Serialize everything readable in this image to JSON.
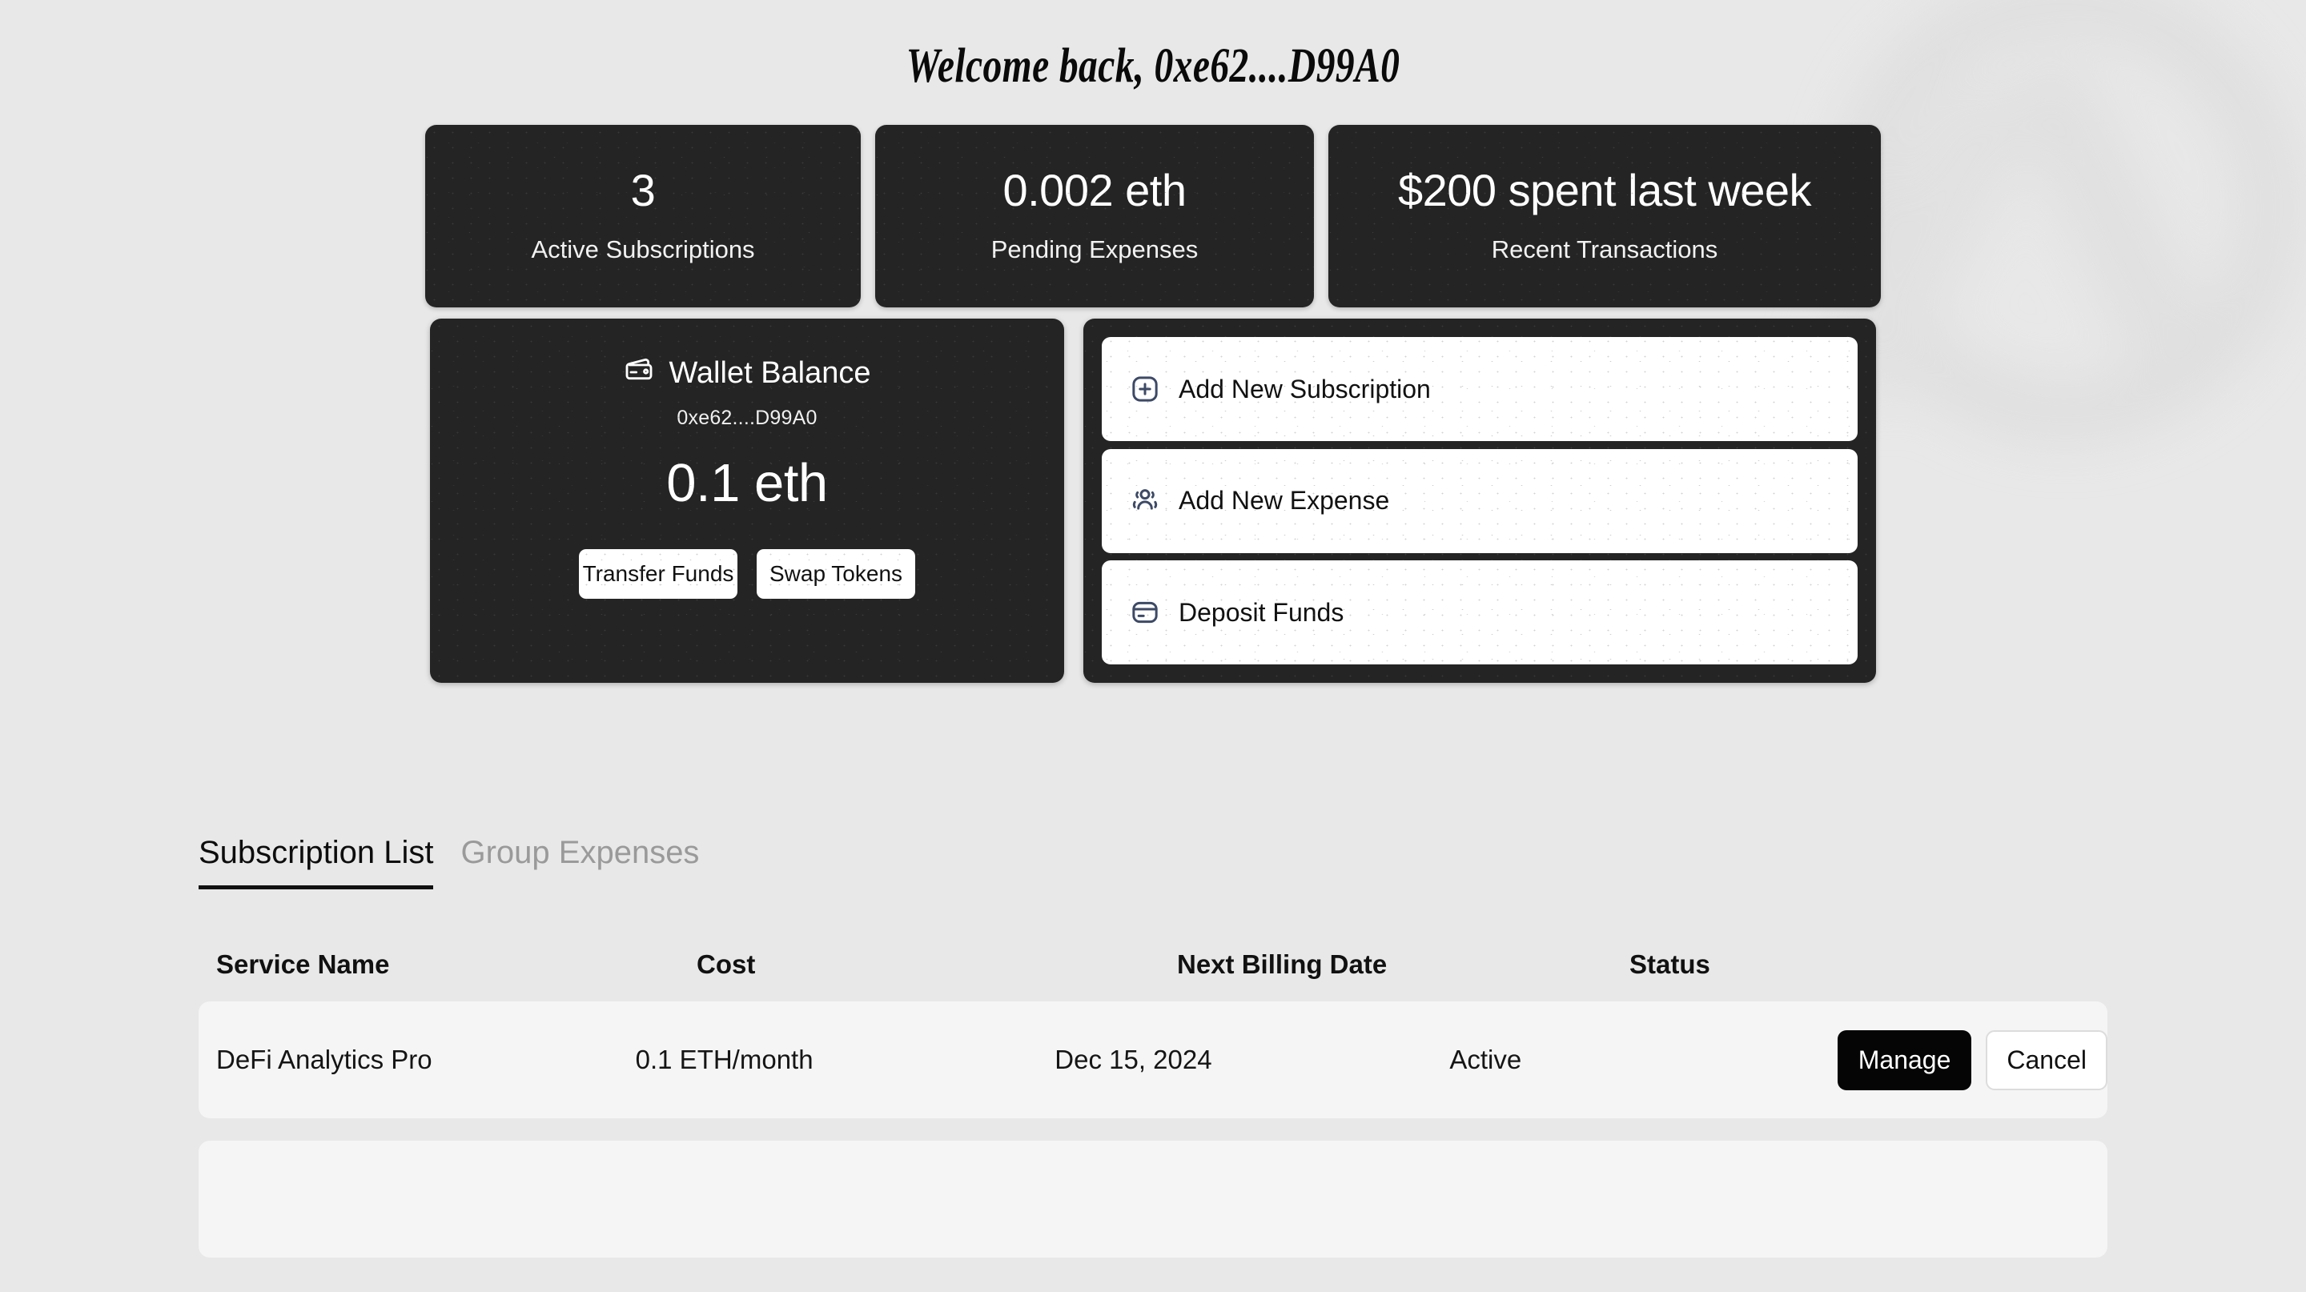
{
  "header": {
    "welcome_text": "Welcome back, 0xe62....D99A0"
  },
  "stats": [
    {
      "value": "3",
      "label": "Active Subscriptions"
    },
    {
      "value": "0.002 eth",
      "label": "Pending Expenses"
    },
    {
      "value": "$200 spent last week",
      "label": "Recent Transactions"
    }
  ],
  "wallet": {
    "icon": "wallet-icon",
    "title": "Wallet Balance",
    "address": "0xe62....D99A0",
    "balance": "0.1 eth",
    "transfer_label": "Transfer Funds",
    "swap_label": "Swap Tokens"
  },
  "actions": [
    {
      "icon": "plus-square-icon",
      "label": "Add New Subscription"
    },
    {
      "icon": "users-icon",
      "label": "Add New Expense"
    },
    {
      "icon": "credit-card-icon",
      "label": "Deposit Funds"
    }
  ],
  "tabs": [
    {
      "label": "Subscription List",
      "active": true
    },
    {
      "label": "Group Expenses",
      "active": false
    }
  ],
  "table": {
    "columns": [
      "Service Name",
      "Cost",
      "Next Billing Date",
      "Status"
    ],
    "rows": [
      {
        "service": "DeFi Analytics Pro",
        "cost": "0.1 ETH/month",
        "next_billing": "Dec 15, 2024",
        "status": "Active",
        "manage_label": "Manage",
        "cancel_label": "Cancel"
      }
    ]
  },
  "colors": {
    "background": "#e8e8e8",
    "card_dark": "#242424",
    "accent_icon": "#3d4a66",
    "row_bg": "#f5f5f5",
    "tab_inactive": "#9a9a9a"
  }
}
